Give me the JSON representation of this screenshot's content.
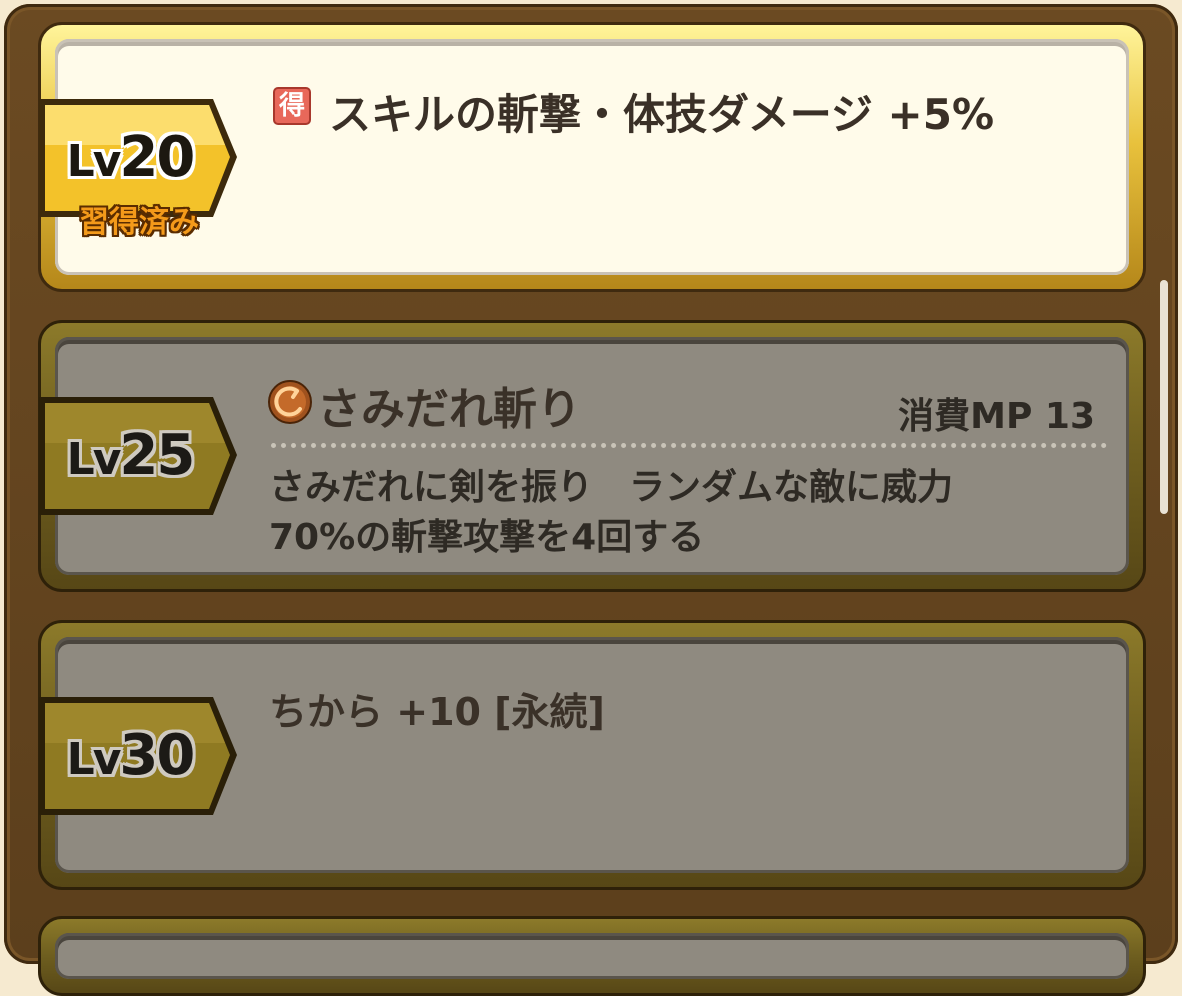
{
  "skills": [
    {
      "level_prefix": "Lv",
      "level": "20",
      "status": "習得済み",
      "badge": "得",
      "title": "スキルの斬撃・体技ダメージ +5%",
      "learned": true
    },
    {
      "level_prefix": "Lv",
      "level": "25",
      "icon": "slash-skill-icon",
      "title": "さみだれ斬り",
      "mp_cost": "消費MP 13",
      "description_line1": "さみだれに剣を振り　ランダムな敵に威力",
      "description_line2": "70%の斬撃攻撃を4回する",
      "learned": false
    },
    {
      "level_prefix": "Lv",
      "level": "30",
      "title": "ちから +10 [永続]",
      "learned": false
    }
  ],
  "colors": {
    "frame": "#5c3f1c",
    "gold": "#e8c13c",
    "active_panel": "#fffbea",
    "inactive_panel": "#8f8a80",
    "learned_text": "#f49a1a"
  }
}
